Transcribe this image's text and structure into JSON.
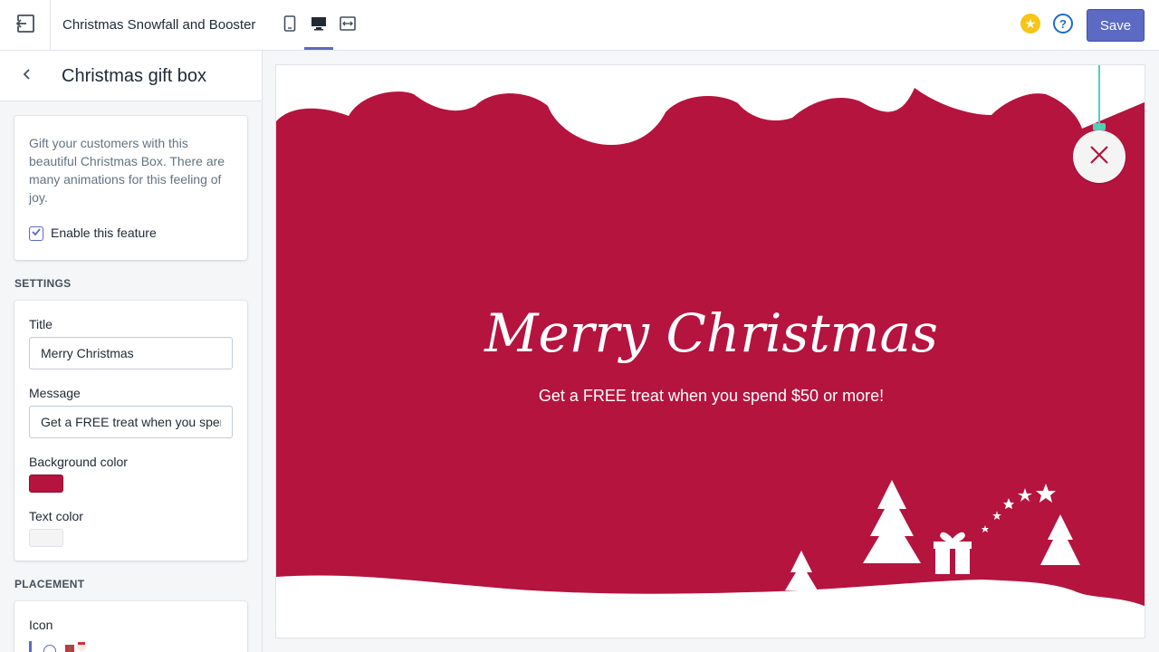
{
  "topbar": {
    "app_title": "Christmas Snowfall and Booster",
    "save_label": "Save",
    "help_label": "?",
    "star_label": "★"
  },
  "sidebar": {
    "title": "Christmas gift box",
    "description": "Gift your customers with this beautiful Christmas Box. There are many animations for this feeling of joy.",
    "enable_label": "Enable this feature",
    "enabled": true,
    "settings": {
      "heading": "SETTINGS",
      "title_label": "Title",
      "title_value": "Merry Christmas",
      "message_label": "Message",
      "message_value": "Get a FREE treat when you spend $50 or more!",
      "bg_color_label": "Background color",
      "bg_color": "#b5143f",
      "text_color_label": "Text color",
      "text_color": "#f4f4f4"
    },
    "placement": {
      "heading": "PLACEMENT",
      "icon_label": "Icon"
    }
  },
  "preview": {
    "title": "Merry Christmas",
    "message": "Get a FREE treat when you spend $50 or more!"
  },
  "colors": {
    "accent": "#5c6ac4",
    "brand_red": "#b5143f",
    "ornament_string": "#4fd1b8"
  }
}
